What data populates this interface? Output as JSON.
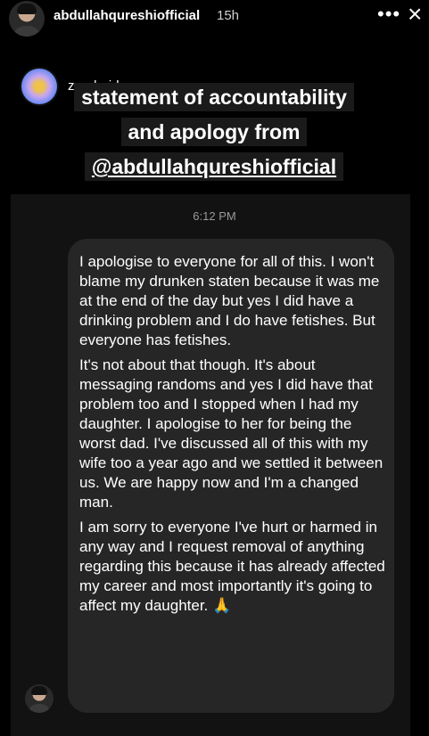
{
  "story": {
    "username": "abdullahqureshiofficial",
    "time_ago": "15h",
    "more_icon": "more-horizontal-icon",
    "close_icon": "close-icon"
  },
  "repost": {
    "username": "zarahaider"
  },
  "caption": {
    "line1": "statement of accountability",
    "line2": "and apology from",
    "line3": "@abdullahqureshiofficial"
  },
  "chat": {
    "timestamp": "6:12 PM",
    "paragraphs": [
      "I apologise to everyone for all of this. I won't blame my drunken staten because it was me at the end of the day but yes I did have a drinking problem and I do have fetishes. But everyone has fetishes.",
      "It's not about that though. It's about messaging randoms and yes I did have that problem too and I stopped when I had my daughter. I apologise to her for being the worst dad. I've discussed all of this with my wife too a year ago and we settled it between us. We are happy now and I'm a changed man.",
      "I am sorry to everyone I've hurt or harmed in any way and I request removal of anything regarding this because it has already affected my career and most importantly it's going to affect my daughter."
    ],
    "emoji": "🙏"
  },
  "colors": {
    "background": "#000000",
    "panel": "#121212",
    "bubble": "#262626",
    "caption_bg": "#1a1a1a"
  }
}
